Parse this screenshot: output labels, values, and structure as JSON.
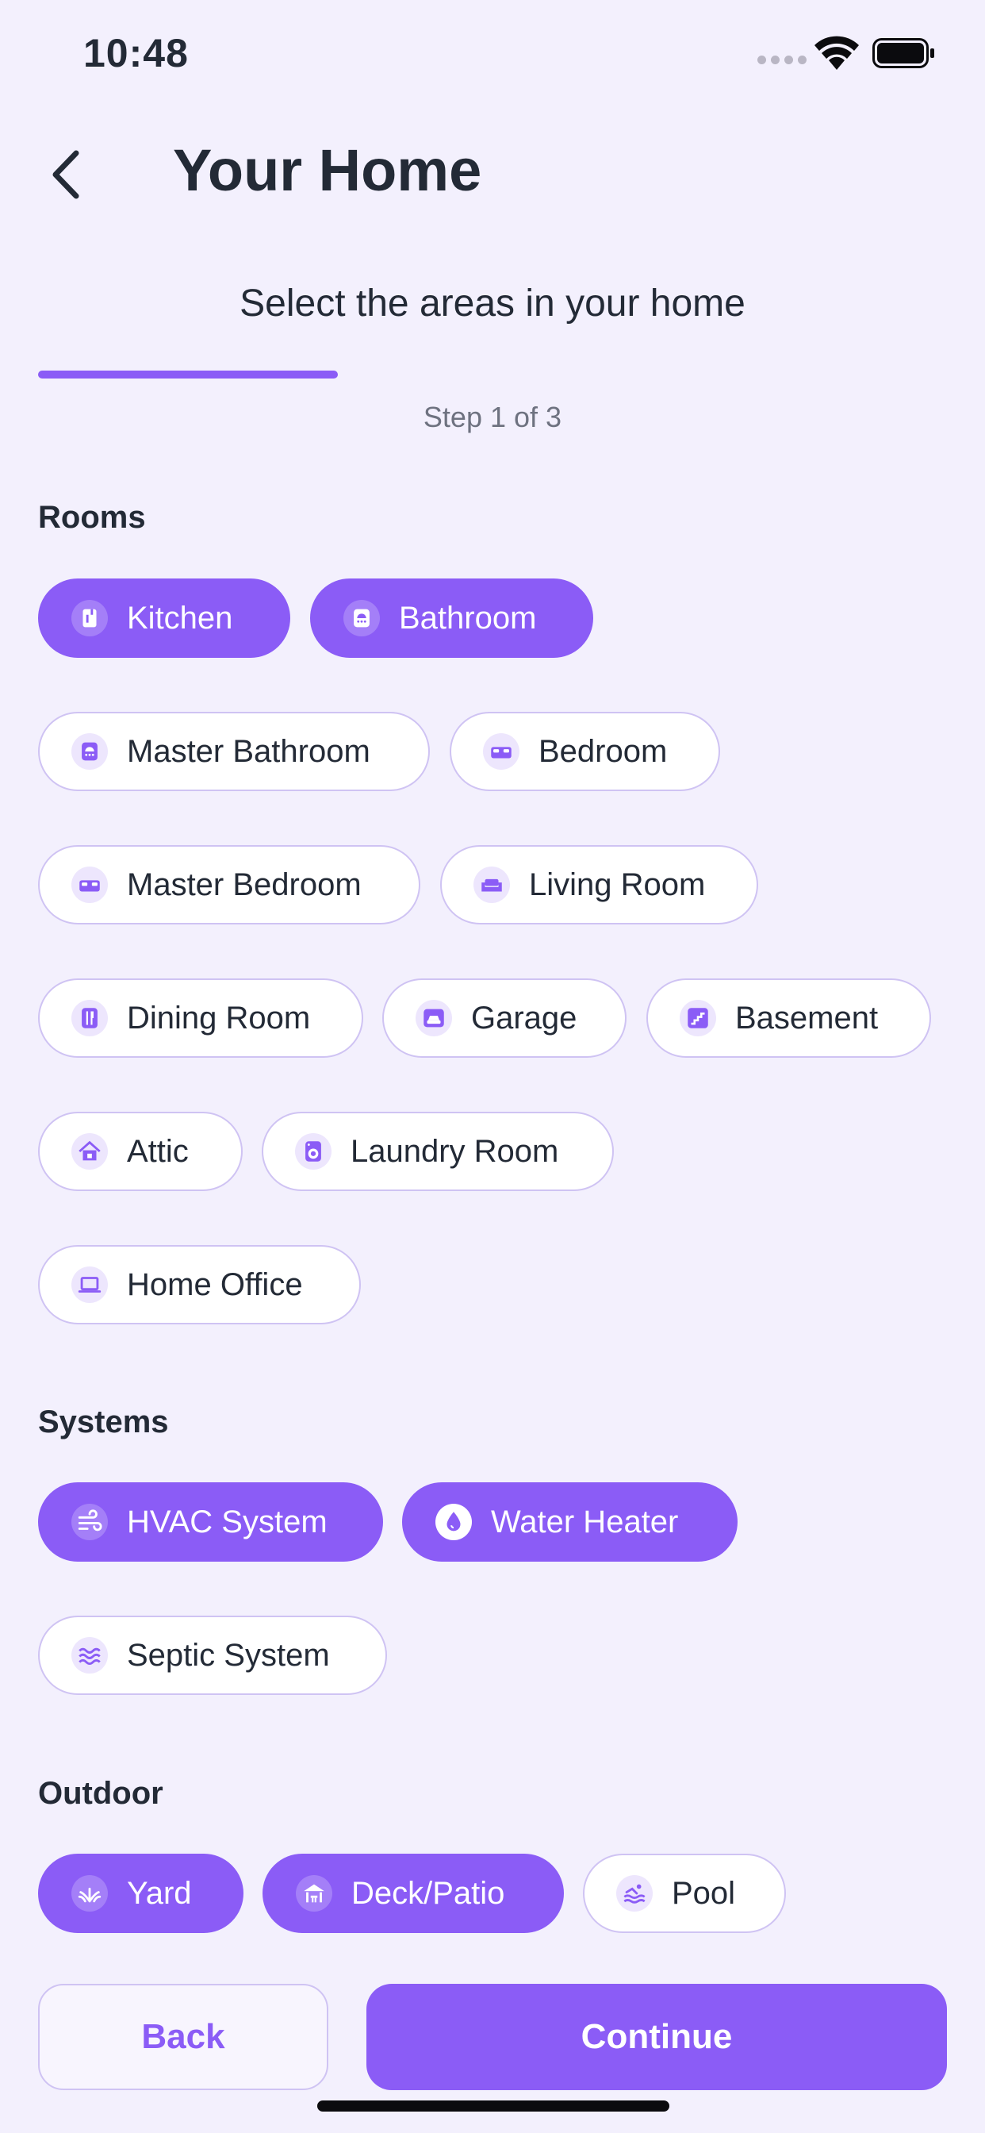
{
  "status_bar": {
    "time": "10:48"
  },
  "header": {
    "title": "Your Home"
  },
  "subtitle": "Select the areas in your home",
  "step_text": "Step 1 of 3",
  "progress": {
    "value": 0.33
  },
  "sections": {
    "rooms": {
      "title": "Rooms",
      "items": [
        {
          "label": "Kitchen",
          "icon": "kitchen-icon",
          "selected": true
        },
        {
          "label": "Bathroom",
          "icon": "shower-icon",
          "selected": true
        },
        {
          "label": "Master Bathroom",
          "icon": "shower-icon",
          "selected": false
        },
        {
          "label": "Bedroom",
          "icon": "bed-icon",
          "selected": false
        },
        {
          "label": "Master Bedroom",
          "icon": "bed-icon",
          "selected": false
        },
        {
          "label": "Living Room",
          "icon": "sofa-icon",
          "selected": false
        },
        {
          "label": "Dining Room",
          "icon": "utensils-icon",
          "selected": false
        },
        {
          "label": "Garage",
          "icon": "car-icon",
          "selected": false
        },
        {
          "label": "Basement",
          "icon": "stairs-icon",
          "selected": false
        },
        {
          "label": "Attic",
          "icon": "house-icon",
          "selected": false
        },
        {
          "label": "Laundry Room",
          "icon": "washing-machine-icon",
          "selected": false
        },
        {
          "label": "Home Office",
          "icon": "laptop-icon",
          "selected": false
        }
      ]
    },
    "systems": {
      "title": "Systems",
      "items": [
        {
          "label": "HVAC System",
          "icon": "wind-icon",
          "selected": true
        },
        {
          "label": "Water Heater",
          "icon": "water-drop-icon",
          "selected": true
        },
        {
          "label": "Septic System",
          "icon": "waves-icon",
          "selected": false
        }
      ]
    },
    "outdoor": {
      "title": "Outdoor",
      "items": [
        {
          "label": "Yard",
          "icon": "grass-icon",
          "selected": true
        },
        {
          "label": "Deck/Patio",
          "icon": "deck-icon",
          "selected": true
        },
        {
          "label": "Pool",
          "icon": "pool-icon",
          "selected": false
        }
      ]
    }
  },
  "buttons": {
    "back": "Back",
    "continue": "Continue"
  },
  "colors": {
    "accent": "#8B5CF6",
    "background": "#F3F0FD",
    "chip_border": "#CFC3F3",
    "text": "#232A36"
  }
}
